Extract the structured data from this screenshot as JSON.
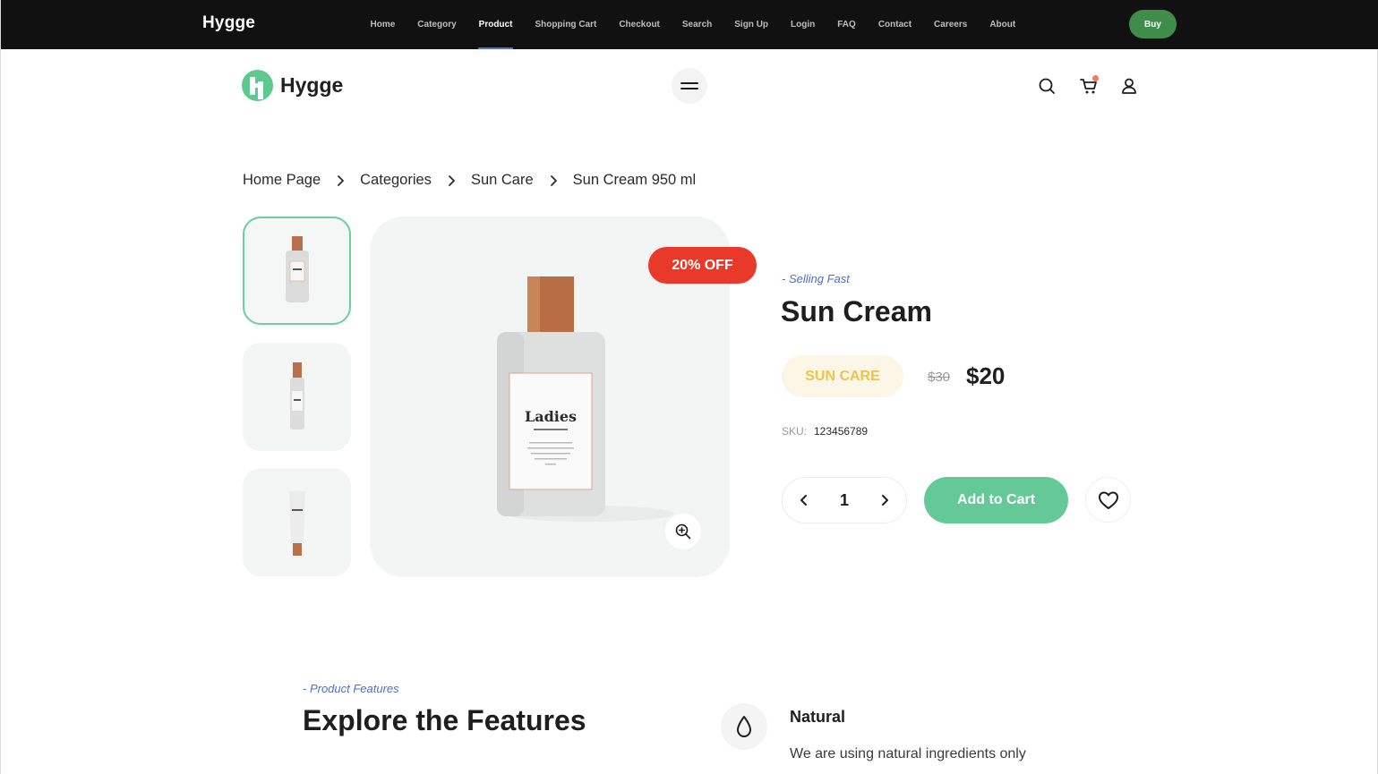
{
  "topbar": {
    "brand": "Hygge",
    "nav": [
      "Home",
      "Category",
      "Product",
      "Shopping Cart",
      "Checkout",
      "Search",
      "Sign Up",
      "Login",
      "FAQ",
      "Contact",
      "Careers",
      "About"
    ],
    "active": "Product",
    "buy_label": "Buy"
  },
  "header": {
    "logo_text": "Hygge",
    "icons": [
      "menu-icon",
      "search-icon",
      "cart-icon",
      "user-icon"
    ]
  },
  "breadcrumb": [
    "Home Page",
    "Categories",
    "Sun Care",
    "Sun Cream 950 ml"
  ],
  "gallery": {
    "discount_label": "20% OFF",
    "bottle_label": "Ladies"
  },
  "product": {
    "tagline": "- Selling Fast",
    "title": "Sun Cream",
    "category": "SUN CARE",
    "old_price": "$30",
    "price": "$20",
    "sku_label": "SKU:",
    "sku": "123456789",
    "quantity": "1",
    "add_to_cart_label": "Add to Cart"
  },
  "features": {
    "tagline": "- Product Features",
    "title": "Explore the Features",
    "items": [
      {
        "name": "Natural",
        "desc": "We are using natural ingredients only",
        "icon": "drop-icon"
      }
    ]
  },
  "colors": {
    "accent_green": "#64c996",
    "discount_red": "#e8392a",
    "tagline_blue": "#4a6fd6",
    "badge_yellow": "#f1c24a"
  }
}
